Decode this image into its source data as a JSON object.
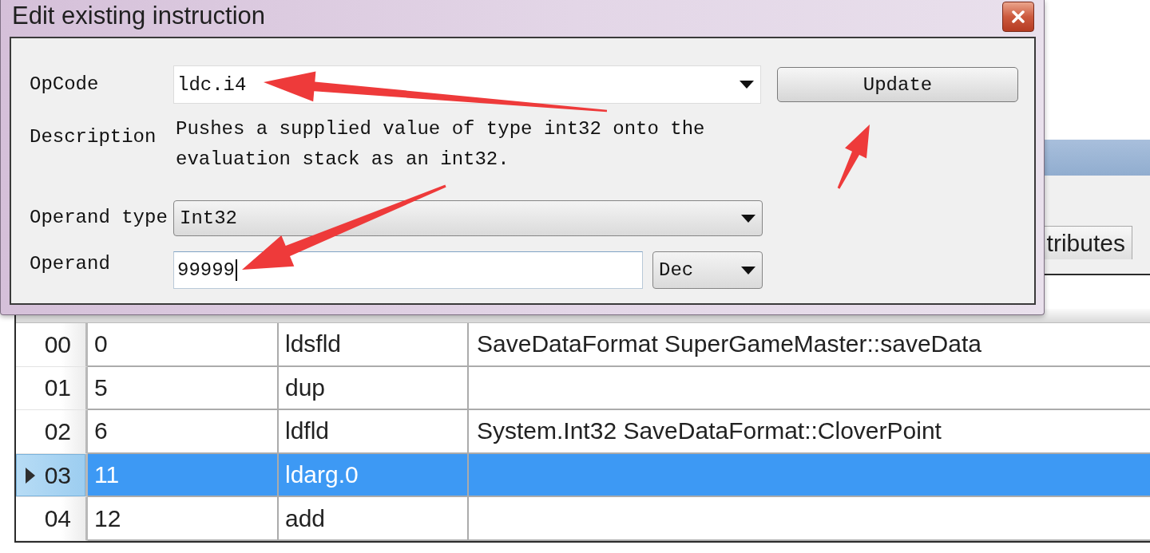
{
  "dialog": {
    "title": "Edit existing instruction",
    "opcode": {
      "label": "OpCode",
      "value": "ldc.i4"
    },
    "update_button": {
      "label": "Update"
    },
    "description": {
      "label": "Description",
      "text": "Pushes a supplied value of type int32 onto the evaluation stack as an int32."
    },
    "operand_type": {
      "label": "Operand type",
      "value": "Int32"
    },
    "operand": {
      "label": "Operand",
      "value": "99999",
      "focused": true,
      "format": "Dec"
    }
  },
  "tabs": [
    {
      "label": "tributes"
    }
  ],
  "table": {
    "rows": [
      {
        "label": "00",
        "cells": [
          "0",
          "ldsfld",
          "SaveDataFormat SuperGameMaster::saveData"
        ],
        "selected": false
      },
      {
        "label": "01",
        "cells": [
          "5",
          "dup"
        ],
        "selected": false
      },
      {
        "label": "02",
        "cells": [
          "6",
          "ldfld",
          "System.Int32 SaveDataFormat::CloverPoint"
        ],
        "selected": false
      },
      {
        "label": "03",
        "cells": [
          "11",
          "ldarg.0"
        ],
        "selected": true
      },
      {
        "label": "04",
        "cells": [
          "12",
          "add"
        ],
        "selected": false
      }
    ]
  }
}
